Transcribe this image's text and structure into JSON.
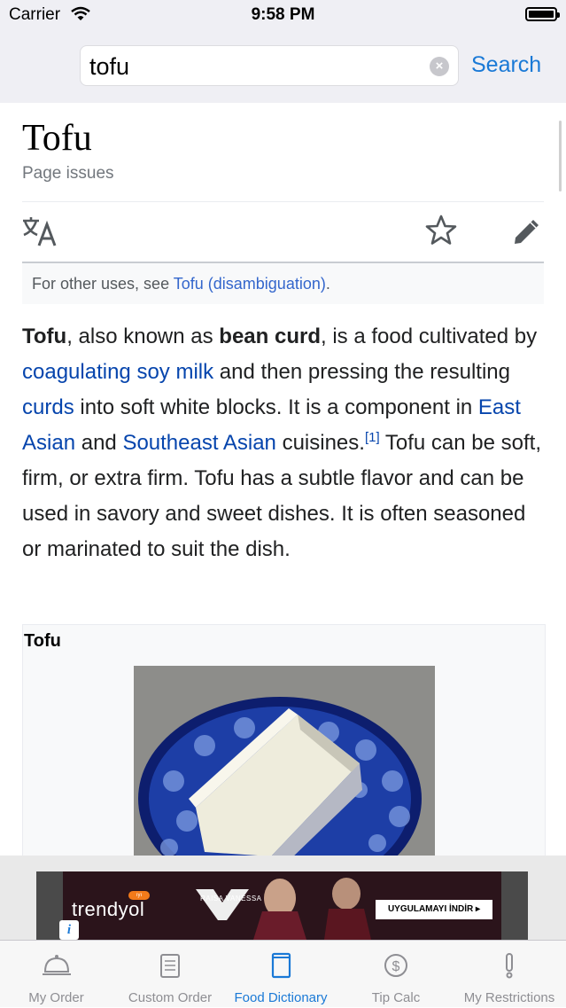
{
  "status_bar": {
    "carrier": "Carrier",
    "time": "9:58 PM"
  },
  "search": {
    "query": "tofu",
    "button_label": "Search"
  },
  "article": {
    "title": "Tofu",
    "page_issues": "Page issues",
    "hatnote": {
      "prefix": "For other uses, see ",
      "link": "Tofu (disambiguation)",
      "suffix": "."
    },
    "paragraph": {
      "b1": "Tofu",
      "t1": ", also known as ",
      "b2": "bean curd",
      "t2": ", is a food cultivated by ",
      "l1": "coagulating",
      "t3": " ",
      "l2": "soy milk",
      "t4": " and then pressing the resulting ",
      "l3": "curds",
      "t5": " into soft white blocks. It is a component in ",
      "l4": "East Asian",
      "t6": " and ",
      "l5": "Southeast Asian",
      "t7": " cuisines.",
      "ref": "[1]",
      "t8": " Tofu can be soft, firm, or extra firm. Tofu has a subtle flavor and can be used in savory and sweet dishes. It is often seasoned or marinated to suit the dish."
    },
    "infobox_title": "Tofu"
  },
  "ad": {
    "brand": "trendyol",
    "brand_badge": "ıyı",
    "sub": "RAISA VANESSA",
    "cta": "UYGULAMAYI İNDİR ▸"
  },
  "tabs": [
    {
      "label": "My Order",
      "icon": "cloche-icon",
      "active": false
    },
    {
      "label": "Custom Order",
      "icon": "notepad-icon",
      "active": false
    },
    {
      "label": "Food Dictionary",
      "icon": "book-icon",
      "active": true
    },
    {
      "label": "Tip Calc",
      "icon": "dollar-icon",
      "active": false
    },
    {
      "label": "My Restrictions",
      "icon": "exclamation-icon",
      "active": false
    }
  ],
  "colors": {
    "accent": "#1a79d6",
    "link": "#0645ad",
    "tab_inactive": "#8e8e93"
  }
}
